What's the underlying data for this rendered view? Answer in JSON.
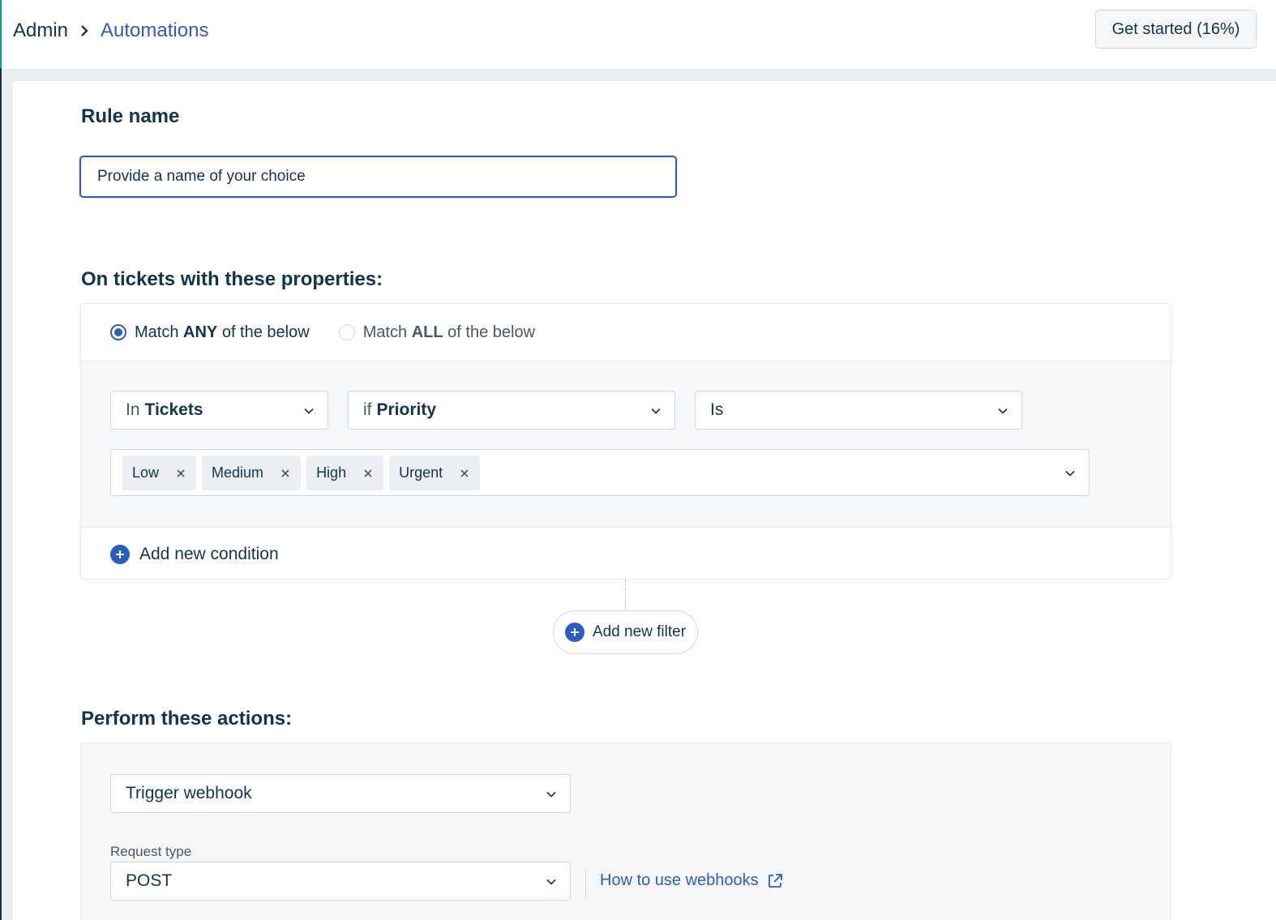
{
  "breadcrumb": {
    "root": "Admin",
    "current": "Automations"
  },
  "header": {
    "get_started_label": "Get started (16%)"
  },
  "rule_name": {
    "label": "Rule name",
    "value": "Provide a name of your choice"
  },
  "conditions": {
    "title": "On tickets with these properties:",
    "match_any": {
      "prefix": "Match ",
      "strong": "ANY",
      "suffix": " of the below",
      "selected": true
    },
    "match_all": {
      "prefix": "Match ",
      "strong": "ALL",
      "suffix": " of the below",
      "selected": false
    },
    "in_dropdown": {
      "prefix": "In",
      "value": "Tickets"
    },
    "field_dropdown": {
      "prefix": "if",
      "value": "Priority"
    },
    "operator_dropdown": {
      "value": "Is"
    },
    "values": [
      "Low",
      "Medium",
      "High",
      "Urgent"
    ],
    "add_condition_label": "Add new condition"
  },
  "add_filter_label": "Add new filter",
  "actions": {
    "title": "Perform these actions:",
    "action_dropdown": {
      "value": "Trigger webhook"
    },
    "request_type": {
      "label": "Request type",
      "value": "POST"
    },
    "help_link": "How to use webhooks"
  },
  "colors": {
    "accent": "#2c5cc5",
    "text": "#12344d",
    "brand_green": "#00a886"
  }
}
